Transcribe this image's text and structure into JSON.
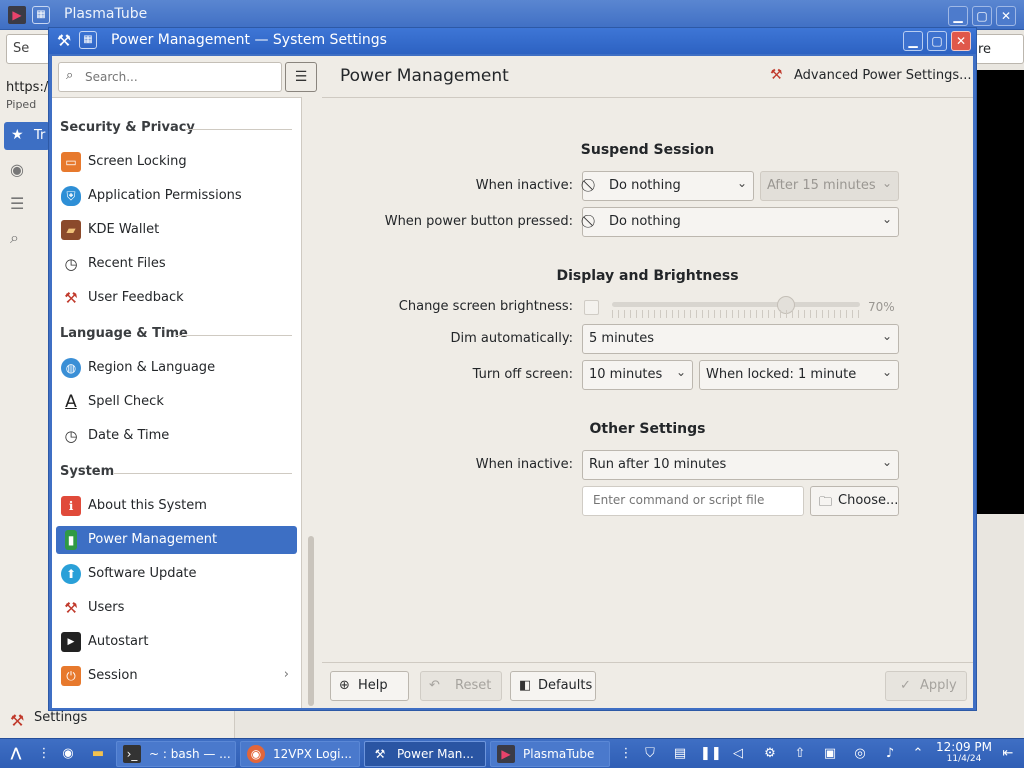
{
  "background_app": {
    "title": "PlasmaTube",
    "url_text": "https:/",
    "piped_label": "Piped",
    "nav_active_label": "Tr",
    "search_text": "Se",
    "right_field_text": "re",
    "bottom_settings_label": "Settings"
  },
  "window": {
    "title": "Power Management — System Settings",
    "minimize": "▁",
    "maximize": "▢",
    "close": "✕"
  },
  "sidebar": {
    "search_placeholder": "Search...",
    "menu_icon": "☰",
    "categories": {
      "security": "Security & Privacy",
      "language": "Language & Time",
      "system": "System"
    },
    "items": {
      "screen_locking": "Screen Locking",
      "app_permissions": "Application Permissions",
      "kde_wallet": "KDE Wallet",
      "recent_files": "Recent Files",
      "user_feedback": "User Feedback",
      "region_language": "Region & Language",
      "spell_check": "Spell Check",
      "date_time": "Date & Time",
      "about_system": "About this System",
      "power_management": "Power Management",
      "software_update": "Software Update",
      "users": "Users",
      "autostart": "Autostart",
      "session": "Session"
    }
  },
  "content": {
    "title": "Power Management",
    "advanced_button": "Advanced Power Settings...",
    "suspend": {
      "heading": "Suspend Session",
      "when_inactive_label": "When inactive:",
      "when_inactive_value": "Do nothing",
      "after_value": "After 15 minutes",
      "power_button_label": "When power button pressed:",
      "power_button_value": "Do nothing"
    },
    "display": {
      "heading": "Display and Brightness",
      "brightness_label": "Change screen brightness:",
      "brightness_value": "70%",
      "brightness_level": 0.7,
      "dim_label": "Dim automatically:",
      "dim_value": "5 minutes",
      "turn_off_label": "Turn off screen:",
      "turn_off_value": "10 minutes",
      "when_locked_value": "When locked: 1 minute"
    },
    "other": {
      "heading": "Other Settings",
      "when_inactive_label": "When inactive:",
      "when_inactive_value": "Run after 10 minutes",
      "command_placeholder": "Enter command or script file",
      "choose_button": "Choose..."
    },
    "footer": {
      "help": "Help",
      "reset": "Reset",
      "defaults": "Defaults",
      "apply": "Apply"
    }
  },
  "taskbar": {
    "tasks": {
      "bash": "~ : bash — ...",
      "browser": "12VPX Logi...",
      "power": "Power Man...",
      "plasmatube": "PlasmaTube"
    },
    "clock_time": "12:09 PM",
    "clock_date": "11/4/24"
  },
  "colors": {
    "accent": "#3d6fc4",
    "window_bg": "#efece6"
  }
}
